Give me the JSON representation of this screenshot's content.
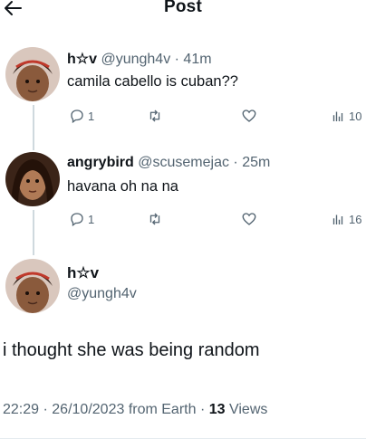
{
  "header": {
    "title": "Post",
    "back_icon": "arrow-left-icon"
  },
  "replies": [
    {
      "display_name": "h☆v",
      "handle": "@yungh4v",
      "time": "41m",
      "text": "camila cabello is cuban??",
      "reply_count": "1",
      "views": "10"
    },
    {
      "display_name": "angrybird",
      "handle": "@scusemejac",
      "time": "25m",
      "text": "havana oh na na",
      "reply_count": "1",
      "views": "16"
    }
  ],
  "main": {
    "display_name": "h☆v",
    "handle": "@yungh4v",
    "text": "i thought she was being random",
    "time": "22:29",
    "date": "26/10/2023",
    "source": "from Earth",
    "views_count": "13",
    "views_label": "Views"
  },
  "colors": {
    "text": "#0f1419",
    "secondary": "#536471",
    "thread_line": "#cfd9de"
  }
}
